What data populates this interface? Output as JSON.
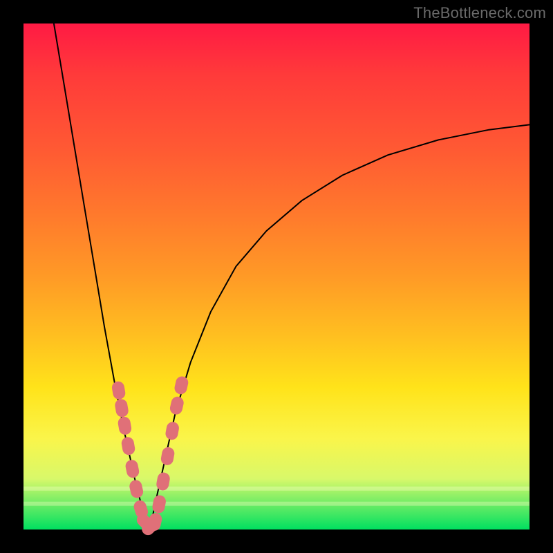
{
  "watermark": "TheBottleneck.com",
  "colors": {
    "gradient_top": "#ff1a44",
    "gradient_mid_orange": "#ff9a26",
    "gradient_yellow": "#ffe31a",
    "gradient_green": "#00e060",
    "curve": "#000000",
    "bead": "#e07078",
    "frame": "#000000"
  },
  "chart_data": {
    "type": "line",
    "title": "",
    "xlabel": "",
    "ylabel": "",
    "xlim": [
      0,
      100
    ],
    "ylim": [
      0,
      100
    ],
    "series": [
      {
        "name": "left-branch",
        "x": [
          6,
          8,
          10,
          12,
          14,
          16,
          18,
          20,
          22,
          23.5,
          25
        ],
        "y": [
          100,
          88,
          76,
          64,
          52,
          40,
          29,
          19,
          10,
          4,
          0
        ]
      },
      {
        "name": "right-branch",
        "x": [
          25,
          26,
          28,
          30,
          33,
          37,
          42,
          48,
          55,
          63,
          72,
          82,
          92,
          100
        ],
        "y": [
          0,
          5,
          14,
          23,
          33,
          43,
          52,
          59,
          65,
          70,
          74,
          77,
          79,
          80
        ]
      }
    ],
    "annotations": [
      {
        "name": "bead-cluster-left",
        "x_range": [
          18.5,
          23.5
        ],
        "y_range": [
          4,
          30
        ]
      },
      {
        "name": "bead-cluster-right",
        "x_range": [
          26,
          31
        ],
        "y_range": [
          5,
          28
        ]
      },
      {
        "name": "bead-trough",
        "x_range": [
          23,
          27
        ],
        "y_range": [
          0,
          3
        ]
      }
    ],
    "beads": [
      {
        "x": 18.8,
        "y": 27.5
      },
      {
        "x": 19.4,
        "y": 24.0
      },
      {
        "x": 20.0,
        "y": 20.5
      },
      {
        "x": 20.7,
        "y": 16.5
      },
      {
        "x": 21.5,
        "y": 12.0
      },
      {
        "x": 22.3,
        "y": 8.0
      },
      {
        "x": 23.2,
        "y": 4.0
      },
      {
        "x": 24.0,
        "y": 1.5
      },
      {
        "x": 25.0,
        "y": 0.5
      },
      {
        "x": 26.0,
        "y": 1.5
      },
      {
        "x": 26.8,
        "y": 5.0
      },
      {
        "x": 27.6,
        "y": 9.5
      },
      {
        "x": 28.5,
        "y": 14.5
      },
      {
        "x": 29.4,
        "y": 19.5
      },
      {
        "x": 30.3,
        "y": 24.5
      },
      {
        "x": 31.2,
        "y": 28.5
      }
    ]
  }
}
